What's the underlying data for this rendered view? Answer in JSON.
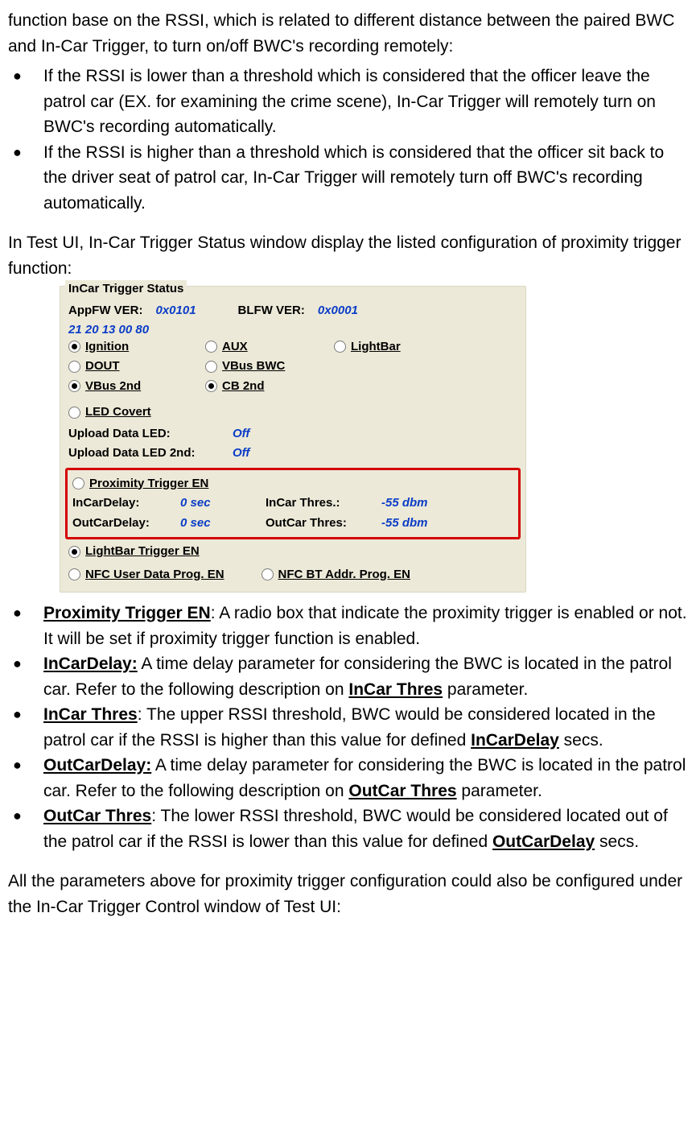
{
  "intro": {
    "p1": "function base on the RSSI, which is related to different distance between the paired BWC and In-Car Trigger, to turn on/off BWC's recording remotely:",
    "b1": "If the RSSI is lower than a threshold which is considered that the officer leave the patrol car (EX. for examining the crime scene), In-Car Trigger will remotely turn on BWC's recording automatically.",
    "b2": "If the RSSI is higher than a threshold which is considered that the officer sit back to the driver seat of patrol car, In-Car Trigger will remotely turn off BWC's recording automatically.",
    "p2": "In Test UI, In-Car Trigger Status window display the listed configuration of proximity trigger function:"
  },
  "shot": {
    "title": "InCar Trigger Status",
    "appfw_label": "AppFW VER:",
    "appfw_val": "0x0101",
    "blfw_label": "BLFW VER:",
    "blfw_val": "0x0001",
    "raw": "21 20 13 00 80",
    "opts": {
      "ignition": "Ignition",
      "aux": "AUX",
      "lightbar": "LightBar",
      "dout": "DOUT",
      "vbusbwc": "VBus BWC",
      "vbus2nd": "VBus 2nd",
      "cb2nd": "CB 2nd",
      "ledcovert": "LED Covert"
    },
    "uploadled_label": "Upload Data LED:",
    "uploadled_val": "Off",
    "uploadled2_label": "Upload Data LED 2nd:",
    "uploadled2_val": "Off",
    "hl": {
      "prox_en": "Proximity Trigger EN",
      "incardelay_label": "InCarDelay:",
      "incardelay_val": "0 sec",
      "incarthres_label": "InCar Thres.:",
      "incarthres_val": "-55 dbm",
      "outcardelay_label": "OutCarDelay:",
      "outcardelay_val": "0 sec",
      "outcarthres_label": "OutCar Thres:",
      "outcarthres_val": "-55 dbm"
    },
    "lightbar_en": "LightBar Trigger EN",
    "nfc1": "NFC User Data Prog. EN",
    "nfc2": "NFC BT Addr. Prog. EN"
  },
  "defs": {
    "prox_en_t": "Proximity Trigger EN",
    "prox_en_b": ": A radio box that indicate the proximity trigger is enabled or not. It will be set if proximity trigger function is enabled.",
    "incardelay_t": "InCarDelay:",
    "incardelay_b1": " A time delay parameter for considering the BWC is located in the patrol car. Refer to the following description on ",
    "incardelay_ref": "InCar Thres",
    "incardelay_b2": " parameter.",
    "incarthres_t": "InCar Thres",
    "incarthres_b1": ": The upper RSSI threshold, BWC would be considered located in the patrol car if the RSSI is higher than this value for defined ",
    "incarthres_ref": "InCarDelay",
    "incarthres_b2": " secs.",
    "outcardelay_t": "OutCarDelay:",
    "outcardelay_b1": " A time delay parameter for considering the BWC is located in the patrol car. Refer to the following description on ",
    "outcardelay_ref": "OutCar Thres",
    "outcardelay_b2": " parameter.",
    "outcarthres_t": "OutCar Thres",
    "outcarthres_b1": ": The lower RSSI threshold, BWC would be considered located out of the patrol car if the RSSI is lower than this value for defined ",
    "outcarthres_ref": "OutCarDelay",
    "outcarthres_b2": " secs."
  },
  "outro": "All the parameters above for proximity trigger configuration could also be configured under the In-Car Trigger Control window of Test UI:"
}
